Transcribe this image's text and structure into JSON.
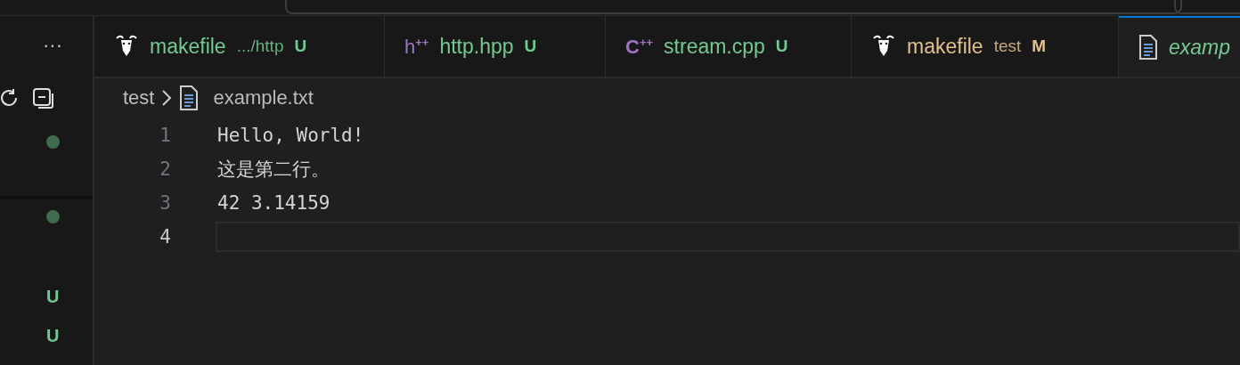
{
  "sidebar": {
    "more_icon": "···",
    "status_marks": [
      {
        "kind": "dot"
      },
      {
        "kind": "dot"
      },
      {
        "kind": "letter",
        "text": "U"
      },
      {
        "kind": "letter",
        "text": "U"
      }
    ]
  },
  "tabs": [
    {
      "kind": "gnu",
      "name": "makefile",
      "path": ".../http",
      "status": "U",
      "selected": false
    },
    {
      "kind": "glyph",
      "icon_text": "h$^{++}$",
      "name": "http.hpp",
      "status": "U",
      "selected": false
    },
    {
      "kind": "glyph",
      "icon_text": "**C**$^{++}$",
      "name": "stream.cpp",
      "status": "U",
      "selected": false
    },
    {
      "kind": "gnu",
      "name": "makefile",
      "path": "test",
      "status": "M",
      "selected": false
    },
    {
      "kind": "txt",
      "name": "examp",
      "selected": true
    }
  ],
  "breadcrumb": {
    "folder": "test",
    "file": "example.txt"
  },
  "editor": {
    "lines": [
      {
        "number": "1",
        "text": "Hello, World!",
        "current": false
      },
      {
        "number": "2",
        "text": "这是第二行。",
        "current": false
      },
      {
        "number": "3",
        "text": "42 3.14159",
        "current": false
      },
      {
        "number": "4",
        "current": true
      }
    ]
  }
}
